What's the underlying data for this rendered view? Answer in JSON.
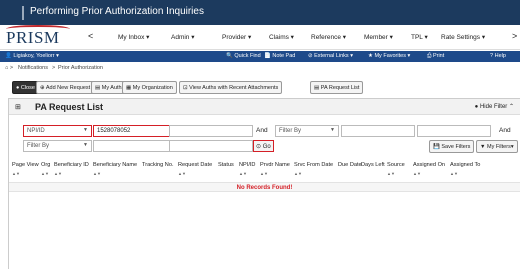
{
  "app": {
    "title": "Performing Prior Authorization Inquiries",
    "logo_text": "PRISM"
  },
  "nav": {
    "back_glyph": "<",
    "forward_glyph": ">",
    "items": [
      {
        "label": "My Inbox"
      },
      {
        "label": "Admin"
      },
      {
        "label": "Provider"
      },
      {
        "label": "Claims"
      },
      {
        "label": "Reference"
      },
      {
        "label": "Member"
      },
      {
        "label": "TPL"
      },
      {
        "label": "Rate Settings"
      }
    ]
  },
  "utility_bar": {
    "user": "Ligiakoy, Yoeliorr",
    "quick_find": "Quick Find",
    "note_pad": "Note Pad",
    "external_links": "External Links",
    "my_favorites": "My Favorites",
    "print": "Print",
    "help": "Help"
  },
  "breadcrumb": {
    "items": [
      "Notifications",
      "Prior Authorization"
    ]
  },
  "toolbar": {
    "close": "Close",
    "add_new_request": "Add New Request",
    "my_auths": "My Auths",
    "my_organization": "My Organization",
    "view_auths_recent": "View Auths with Recent Attachments",
    "pa_request_list": "PA Request List"
  },
  "panel": {
    "title": "PA Request List",
    "hide_filter": "Hide Filter"
  },
  "filters": {
    "filter1_select": "NPI/ID",
    "filter1_value": "1528078052",
    "and_label": "And",
    "filter_by_placeholder": "Filter By",
    "go": "Go",
    "save_filters": "Save Filters",
    "my_filters": "My Filters"
  },
  "table": {
    "columns": [
      "Page View",
      "Org",
      "Beneficiary ID",
      "Beneficiary Name",
      "Tracking No.",
      "Request Date",
      "Status",
      "NPI/ID",
      "Prvdr Name",
      "Srvc From Date",
      "Due Date",
      "Days Left",
      "Source",
      "Assigned On",
      "Assigned To"
    ],
    "empty_message": "No Records Found!"
  },
  "colors": {
    "title_bar": "#1c3a5e",
    "utility_bar": "#1e4a8a",
    "highlight": "#d41f26"
  }
}
